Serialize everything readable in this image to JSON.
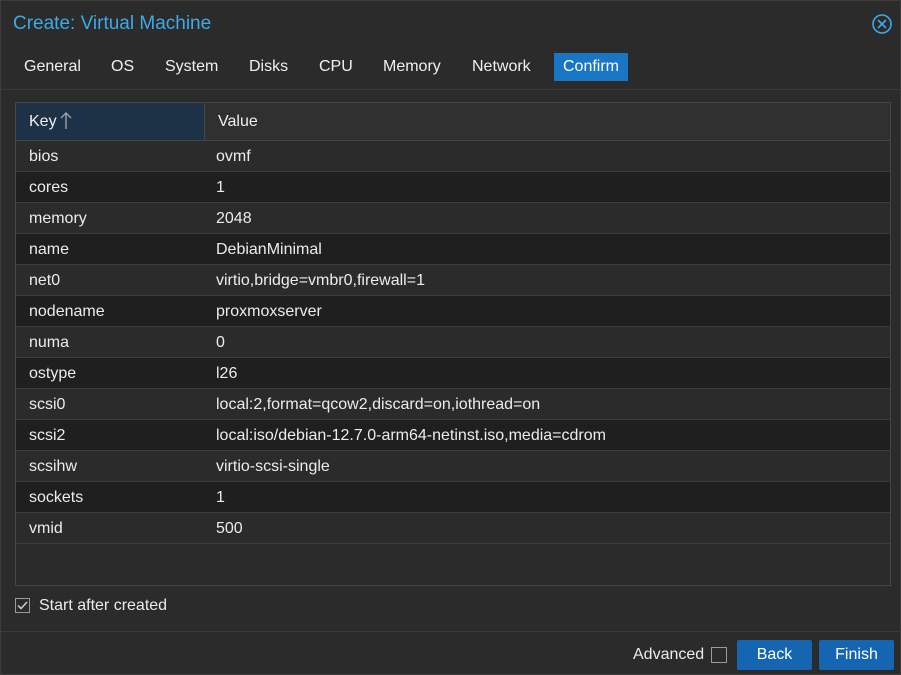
{
  "dialog": {
    "title": "Create: Virtual Machine",
    "close_icon": "close-circle-icon",
    "accent_color": "#3da9e8"
  },
  "tabs": [
    {
      "label": "General",
      "active": false
    },
    {
      "label": "OS",
      "active": false
    },
    {
      "label": "System",
      "active": false
    },
    {
      "label": "Disks",
      "active": false
    },
    {
      "label": "CPU",
      "active": false
    },
    {
      "label": "Memory",
      "active": false
    },
    {
      "label": "Network",
      "active": false
    },
    {
      "label": "Confirm",
      "active": true
    }
  ],
  "grid": {
    "columns": {
      "key": "Key",
      "value": "Value",
      "sort_icon": "arrow-up-icon",
      "sort_direction": "ascending"
    },
    "rows": [
      {
        "key": "bios",
        "value": "ovmf"
      },
      {
        "key": "cores",
        "value": "1"
      },
      {
        "key": "memory",
        "value": "2048"
      },
      {
        "key": "name",
        "value": "DebianMinimal"
      },
      {
        "key": "net0",
        "value": "virtio,bridge=vmbr0,firewall=1"
      },
      {
        "key": "nodename",
        "value": "proxmoxserver"
      },
      {
        "key": "numa",
        "value": "0"
      },
      {
        "key": "ostype",
        "value": "l26"
      },
      {
        "key": "scsi0",
        "value": "local:2,format=qcow2,discard=on,iothread=on"
      },
      {
        "key": "scsi2",
        "value": "local:iso/debian-12.7.0-arm64-netinst.iso,media=cdrom"
      },
      {
        "key": "scsihw",
        "value": "virtio-scsi-single"
      },
      {
        "key": "sockets",
        "value": "1"
      },
      {
        "key": "vmid",
        "value": "500"
      }
    ]
  },
  "start_after_created": {
    "label": "Start after created",
    "checked": true
  },
  "footer": {
    "advanced_label": "Advanced",
    "advanced_checked": false,
    "back_label": "Back",
    "finish_label": "Finish",
    "button_color": "#1565b0"
  }
}
